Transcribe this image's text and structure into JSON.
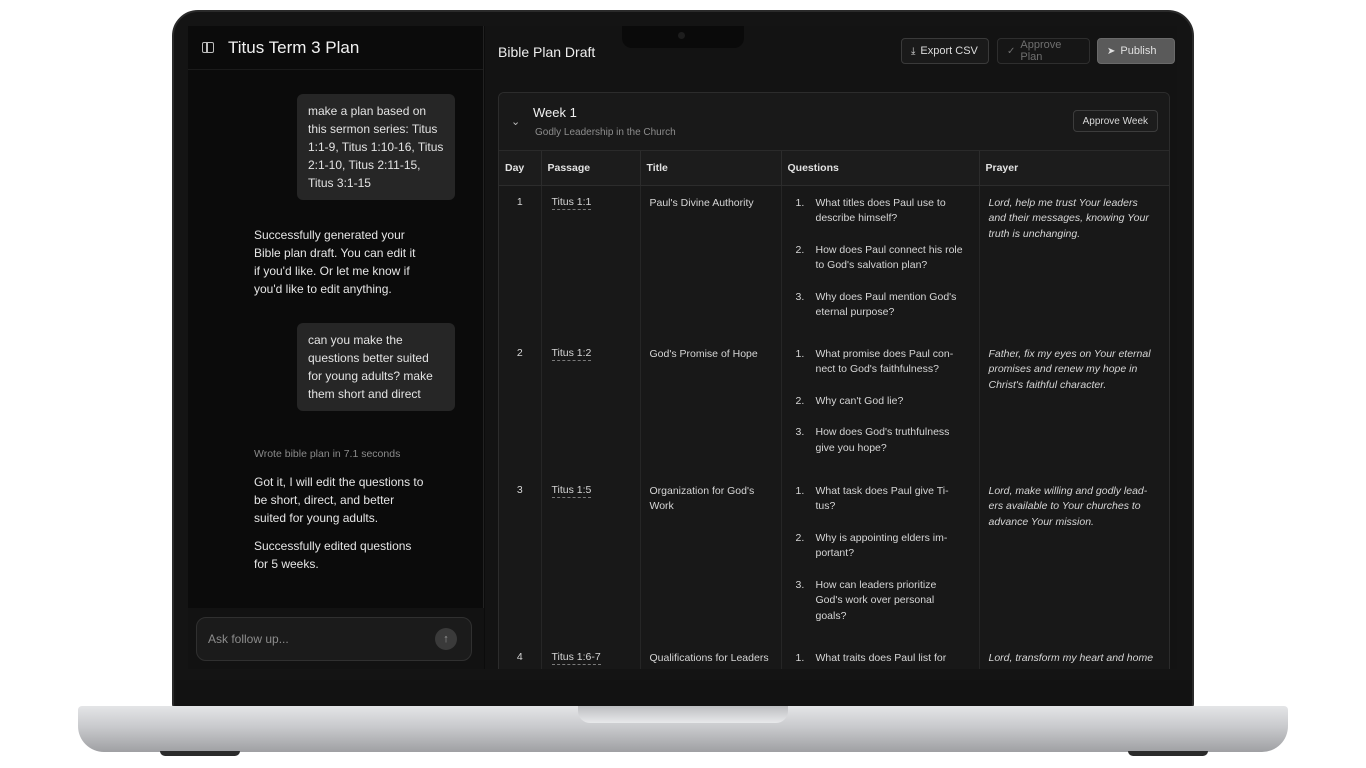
{
  "chat": {
    "title": "Titus Term 3 Plan",
    "messages": [
      {
        "role": "user",
        "text": "make a plan based on this sermon series: Titus 1:1-9, Titus 1:10-16, Titus 2:1-10, Titus 2:11-15, Titus 3:1-15"
      },
      {
        "role": "assistant",
        "text": "Successfully generated your Bible plan draft. You can edit it if you'd like. Or let me know if you'd like to edit anything."
      },
      {
        "role": "user",
        "text": "can you make the questions better suited for young adults? make them short and direct"
      },
      {
        "role": "status",
        "text": "Wrote bible plan in 7.1 seconds"
      },
      {
        "role": "assistant",
        "text": "Got it, I will edit the questions to be short, direct, and better suited for young adults."
      },
      {
        "role": "assistant",
        "text": "Successfully edited questions for 5 weeks."
      }
    ],
    "composer_placeholder": "Ask follow up..."
  },
  "plan": {
    "title": "Bible Plan Draft",
    "toolbar": {
      "export_label": "Export CSV",
      "approve_label": "Approve Plan",
      "publish_label": "Publish"
    },
    "week": {
      "title": "Week 1",
      "subtitle": "Godly Leadership in the Church",
      "approve_label": "Approve Week"
    },
    "columns": [
      "Day",
      "Passage",
      "Title",
      "Questions",
      "Prayer"
    ],
    "rows": [
      {
        "day": "1",
        "passage": "Titus 1:1",
        "title": "Paul's Divine Authority",
        "questions": [
          {
            "num": "1.",
            "text": "What titles does Paul use to describe himself?"
          },
          {
            "num": "2.",
            "text": "How does Paul connect his role to God's salvation plan?"
          },
          {
            "num": "3.",
            "text": "Why does Paul mention God's eternal purpose?"
          }
        ],
        "prayer": "Lord, help me trust Your leaders and their messages, knowing Your truth is unchanging."
      },
      {
        "day": "2",
        "passage": "Titus 1:2",
        "title": "God's Promise of Hope",
        "questions": [
          {
            "num": "1.",
            "text": "What promise does Paul con-nect to God's faithfulness?"
          },
          {
            "num": "2.",
            "text": "Why can't God lie?"
          },
          {
            "num": "3.",
            "text": "How does God's truthfulness give you hope?"
          }
        ],
        "prayer": "Father, fix my eyes on Your eternal promises and renew my hope in Christ's faithful character."
      },
      {
        "day": "3",
        "passage": "Titus 1:5",
        "title": "Organization for God's Work",
        "questions": [
          {
            "num": "1.",
            "text": "What task does Paul give Ti-tus?"
          },
          {
            "num": "2.",
            "text": "Why is appointing elders im-portant?"
          },
          {
            "num": "3.",
            "text": "How can leaders prioritize God's work over personal goals?"
          }
        ],
        "prayer": "Lord, make willing and godly lead-ers available to Your churches to advance Your mission."
      },
      {
        "day": "4",
        "passage": "Titus 1:6-7",
        "title": "Qualifications for Leaders",
        "questions": [
          {
            "num": "1.",
            "text": "What traits does Paul list for"
          }
        ],
        "prayer": "Lord, transform my heart and home"
      }
    ]
  }
}
